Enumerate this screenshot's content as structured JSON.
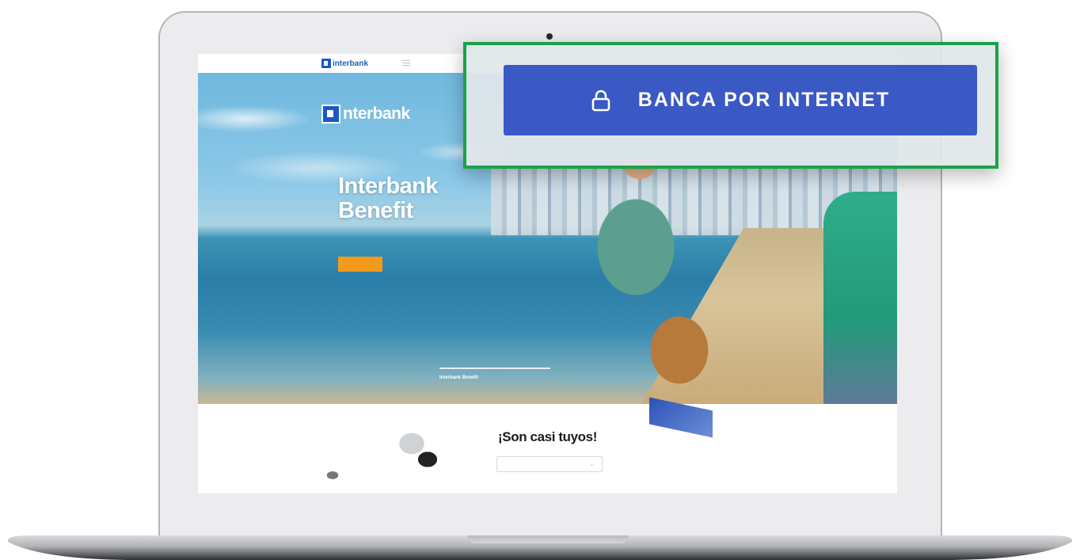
{
  "screen": {
    "topbar": {
      "logo_text": "interbank"
    },
    "hero": {
      "logo_text": "nterbank",
      "title_line1": "Interbank",
      "title_line2": "Benefit",
      "foot_col2_title": "Interbank Benefit"
    },
    "lower": {
      "title": "¡Son casi tuyos!"
    }
  },
  "callout": {
    "button_label": "BANCA POR INTERNET",
    "button_icon": "lock-icon",
    "button_color": "#3a59c4",
    "border_color": "#17a34a"
  }
}
